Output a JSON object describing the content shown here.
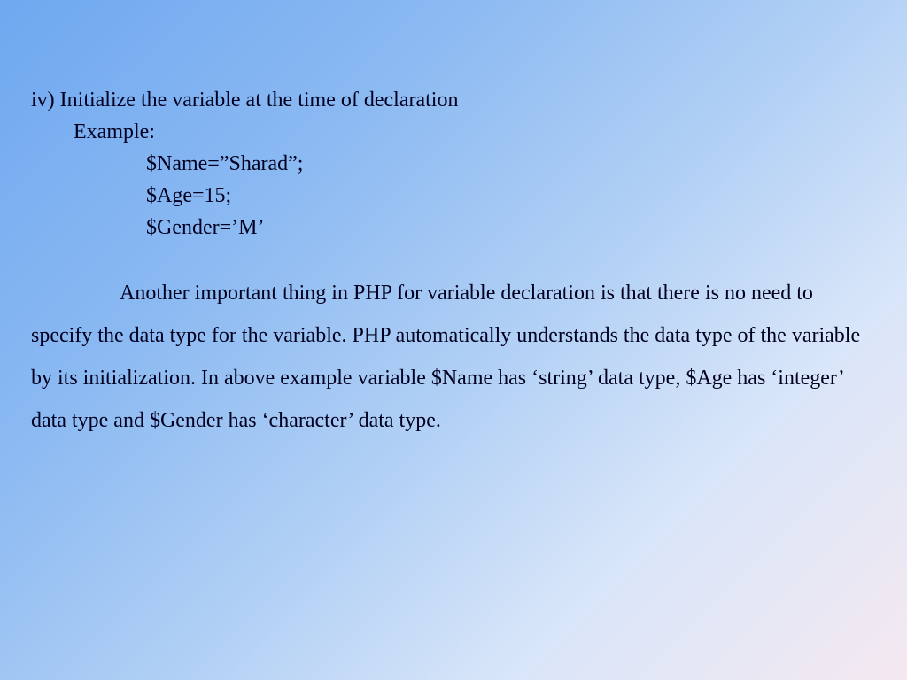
{
  "slide": {
    "heading": "iv) Initialize the variable at the time of declaration",
    "example_label": "Example:",
    "code_lines": [
      "$Name=”Sharad”;",
      "$Age=15;",
      "$Gender=’M’"
    ],
    "paragraph": "Another important thing in PHP for variable declaration is that there is no need to specify the data type for the variable. PHP automatically understands the data type of the variable by its initialization. In above example variable $Name has ‘string’ data type, $Age has ‘integer’ data type and $Gender has ‘character’ data type."
  }
}
